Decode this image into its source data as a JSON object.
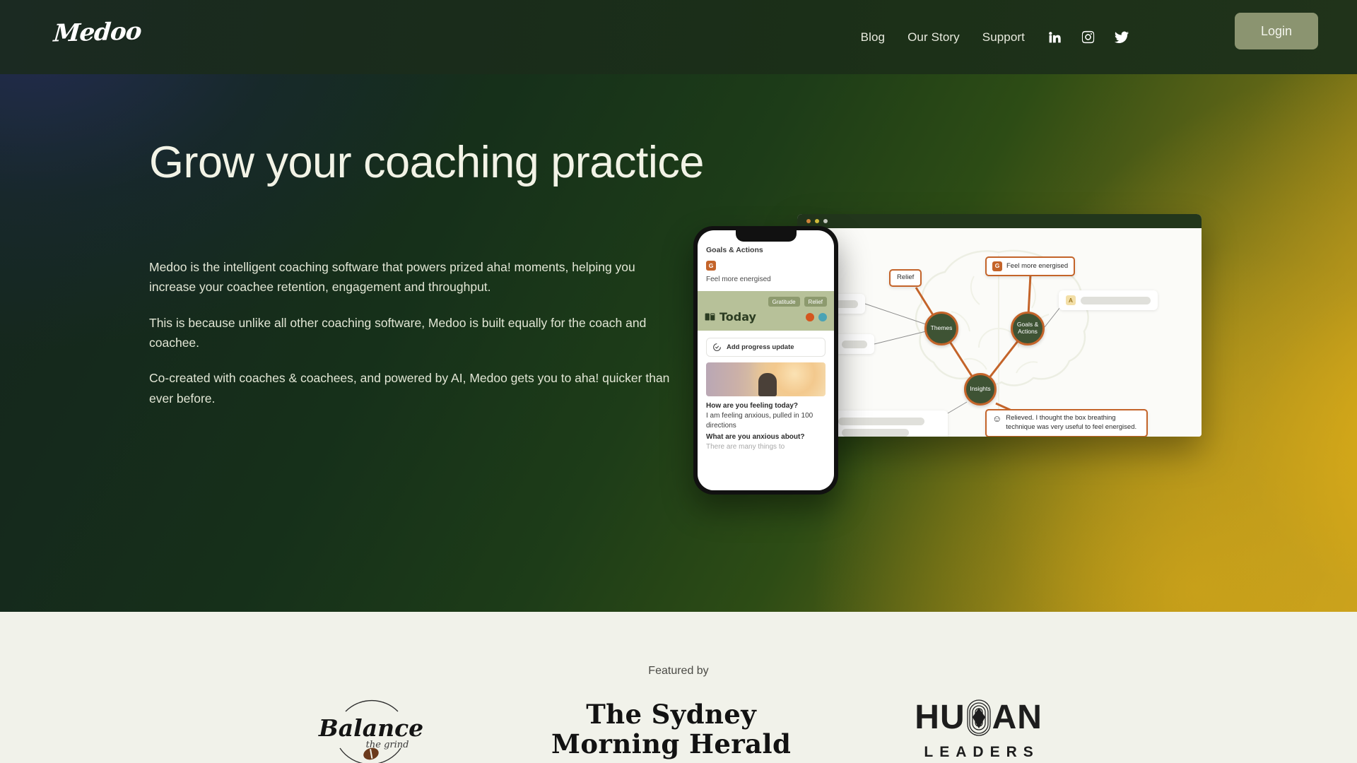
{
  "header": {
    "logo_text": "Medoo",
    "nav": [
      {
        "label": "Blog",
        "name": "nav-blog"
      },
      {
        "label": "Our Story",
        "name": "nav-our-story"
      },
      {
        "label": "Support",
        "name": "nav-support"
      }
    ],
    "socials": [
      {
        "name": "linkedin-icon",
        "label": "LinkedIn"
      },
      {
        "name": "instagram-icon",
        "label": "Instagram"
      },
      {
        "name": "twitter-icon",
        "label": "Twitter"
      }
    ],
    "login_label": "Login"
  },
  "hero": {
    "heading": "Grow your coaching practice",
    "paragraphs": [
      "Medoo is the intelligent coaching software that powers prized aha! moments, helping you increase your coachee retention, engagement and throughput.",
      "This is because unlike all other coaching software, Medoo is built equally for the coach and coachee.",
      "Co-created with coaches & coachees, and powered by AI, Medoo gets you to aha! quicker than ever before."
    ]
  },
  "phone": {
    "section_title": "Goals & Actions",
    "goal_badge": "G",
    "goal_text": "Feel more energised",
    "tags": [
      "Gratitude",
      "Relief"
    ],
    "today_label": "Today",
    "add_update_label": "Add progress update",
    "question_1": "How are you feeling today?",
    "answer_1": "I am feeling anxious, pulled in 100 directions",
    "question_2": "What are you anxious about?",
    "answer_2": "There are many things to"
  },
  "browser": {
    "nodes": [
      {
        "label": "Themes",
        "name": "mindmap-node-themes"
      },
      {
        "label": "Goals & Actions",
        "name": "mindmap-node-goals-actions"
      },
      {
        "label": "Insights",
        "name": "mindmap-node-insights"
      }
    ],
    "card_relief": "Relief",
    "card_energised_badge": "G",
    "card_energised": "Feel more energised",
    "card_relieved": "Relieved. I thought the box breathing technique was very useful to feel energised.",
    "ghost_badge_a": "A"
  },
  "featured": {
    "label": "Featured by",
    "logos": [
      {
        "name": "balance-the-grind-logo",
        "primary": "Balance",
        "secondary": "the grind"
      },
      {
        "name": "sydney-morning-herald-logo",
        "line1": "The Sydney",
        "line2": "Morning Herald"
      },
      {
        "name": "human-leaders-logo",
        "line1_a": "HU",
        "line1_b": "AN",
        "line2": "LEADERS"
      }
    ]
  },
  "colors": {
    "accent_orange": "#c4642a",
    "node_green": "#3e5334",
    "login_button": "#8b9470",
    "featured_bg": "#f1f2ea",
    "hero_text": "#f2f3e6"
  }
}
